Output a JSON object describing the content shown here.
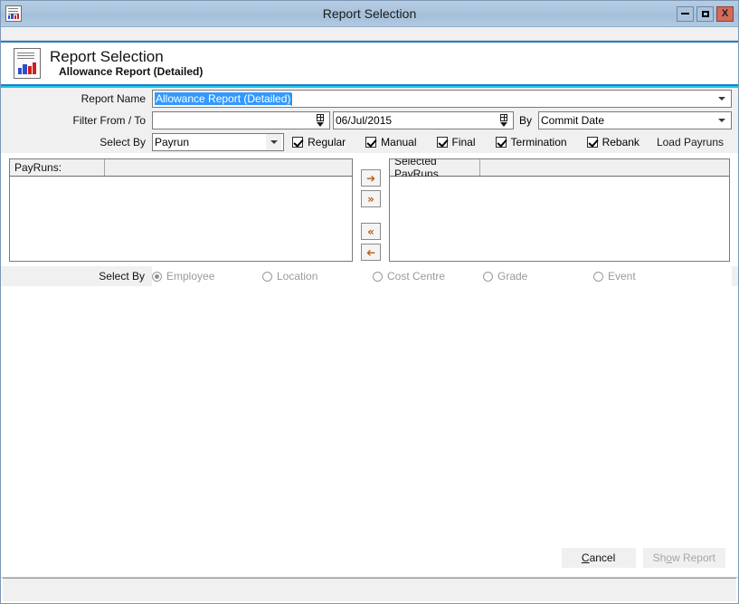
{
  "window": {
    "title": "Report Selection",
    "icon": "report-chart-icon",
    "buttons": {
      "minimize": "minimize-icon",
      "maximize": "maximize-icon",
      "close": "X"
    },
    "accent_blue": "#1d7fc9",
    "accent_cyan": "#1ec8ef",
    "titlebar_color": "#acc6e0"
  },
  "banner": {
    "icon": "report-chart-icon",
    "title": "Report Selection",
    "subtitle": "Allowance Report (Detailed)"
  },
  "form": {
    "report_name": {
      "label": "Report Name",
      "value": "Allowance Report (Detailed)",
      "selected": true
    },
    "filter_range": {
      "label": "Filter From / To",
      "from_value": "",
      "from_placeholder": "",
      "to_value": "06/Jul/2015",
      "by_label": "By",
      "by_value": "Commit Date"
    },
    "select_by": {
      "label": "Select By",
      "value": "Payrun",
      "checkboxes": [
        {
          "label": "Regular",
          "checked": true
        },
        {
          "label": "Manual",
          "checked": true
        },
        {
          "label": "Final",
          "checked": true
        },
        {
          "label": "Termination",
          "checked": true
        },
        {
          "label": "Rebank",
          "checked": true
        }
      ],
      "load_button": "Load Payruns"
    }
  },
  "lists": {
    "available": {
      "header": "PayRuns:",
      "second_col": "",
      "items": []
    },
    "selected": {
      "header": "Selected PayRuns",
      "second_col": "",
      "items": []
    },
    "transfer_buttons": [
      {
        "name": "move-right-button",
        "glyph": "➔"
      },
      {
        "name": "move-all-right-button",
        "glyph": "»"
      },
      {
        "name": "move-all-left-button",
        "glyph": "«"
      },
      {
        "name": "move-left-button",
        "glyph": "➔"
      }
    ]
  },
  "select_by_group": {
    "label": "Select By",
    "options": [
      {
        "label": "Employee",
        "selected": true,
        "disabled": true
      },
      {
        "label": "Location",
        "selected": false,
        "disabled": true
      },
      {
        "label": "Cost Centre",
        "selected": false,
        "disabled": true
      },
      {
        "label": "Grade",
        "selected": false,
        "disabled": true
      },
      {
        "label": "Event",
        "selected": false,
        "disabled": true
      }
    ]
  },
  "footer": {
    "cancel": {
      "prefix": "",
      "accel": "C",
      "rest": "ancel",
      "disabled": false
    },
    "show_report": {
      "prefix": "Sh",
      "accel": "o",
      "rest": "w Report",
      "disabled": true
    }
  },
  "statusbar": {
    "text": ""
  }
}
